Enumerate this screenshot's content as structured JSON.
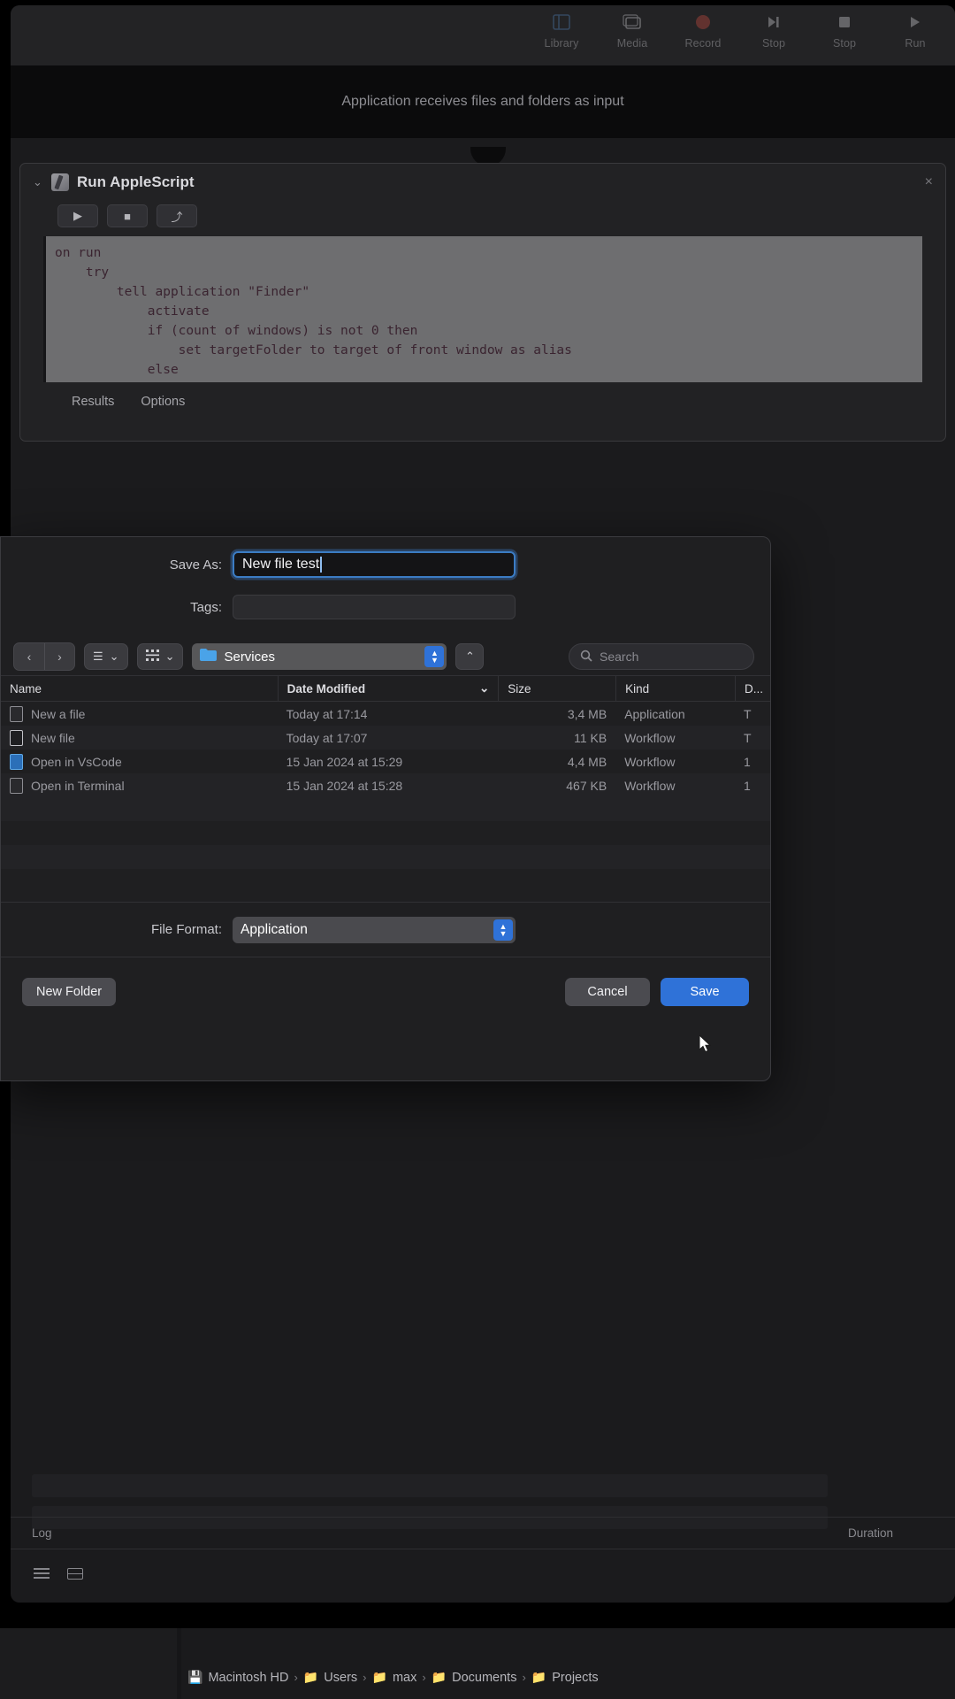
{
  "app": {
    "input_description": "Application receives files and folders as input"
  },
  "toolbar": {
    "items": [
      {
        "label": "Library",
        "icon": "library-icon"
      },
      {
        "label": "Media",
        "icon": "media-icon"
      },
      {
        "label": "Record",
        "icon": "record-icon"
      },
      {
        "label": "Stop",
        "icon": "step-icon"
      },
      {
        "label": "Stop",
        "icon": "stop-icon"
      },
      {
        "label": "Run",
        "icon": "run-icon"
      }
    ]
  },
  "action_card": {
    "title": "Run AppleScript",
    "close_label": "×",
    "chevron": "⌄",
    "script_buttons": [
      {
        "name": "run",
        "glyph": "▶"
      },
      {
        "name": "stop",
        "glyph": "■"
      },
      {
        "name": "compile",
        "glyph": "⤴"
      }
    ],
    "code": "on run\n    try\n        tell application \"Finder\"\n            activate\n            if (count of windows) is not 0 then\n                set targetFolder to target of front window as alias\n            else\n                set targetFolder to (path to desktop folder) as alias",
    "tabs": [
      "Results",
      "Options"
    ]
  },
  "log": {
    "label": "Log",
    "duration_label": "Duration"
  },
  "save_dialog": {
    "save_as_label": "Save As:",
    "save_as_value": "New file test",
    "tags_label": "Tags:",
    "tags_value": "",
    "nav": {
      "back": "‹",
      "forward": "›",
      "list_view": "☰",
      "icon_view": "∷",
      "chevron": "⌄",
      "path_label": "Services",
      "up_label": "⌃",
      "search_placeholder": "Search"
    },
    "columns": [
      "Name",
      "Date Modified",
      "Size",
      "Kind",
      "D..."
    ],
    "sort_column": "Date Modified",
    "files": [
      {
        "icon": "document-icon",
        "name": "New a file",
        "date": "Today at 17:14",
        "size": "3,4 MB",
        "kind": "Application",
        "extra": "T"
      },
      {
        "icon": "workflow-icon",
        "name": "New file",
        "date": "Today at 17:07",
        "size": "11 KB",
        "kind": "Workflow",
        "extra": "T"
      },
      {
        "icon": "vscode-icon",
        "name": "Open in VsCode",
        "date": "15 Jan 2024 at 15:29",
        "size": "4,4 MB",
        "kind": "Workflow",
        "extra": "1"
      },
      {
        "icon": "document-icon",
        "name": "Open in Terminal",
        "date": "15 Jan 2024 at 15:28",
        "size": "467 KB",
        "kind": "Workflow",
        "extra": "1"
      }
    ],
    "file_format_label": "File Format:",
    "file_format_value": "Application",
    "new_folder_label": "New Folder",
    "cancel_label": "Cancel",
    "save_label": "Save"
  },
  "breadcrumb": {
    "items": [
      {
        "label": "Macintosh HD",
        "icon": "harddisk-icon"
      },
      {
        "label": "Users",
        "icon": "folder-icon"
      },
      {
        "label": "max",
        "icon": "folder-icon"
      },
      {
        "label": "Documents",
        "icon": "folder-icon"
      },
      {
        "label": "Projects",
        "icon": "folder-icon"
      }
    ],
    "separator": "›"
  },
  "colors": {
    "accent_blue": "#2f72d8",
    "record_red": "#c04a3e",
    "folder_blue": "#4aa3e8",
    "code_bg": "#6e6e70"
  }
}
